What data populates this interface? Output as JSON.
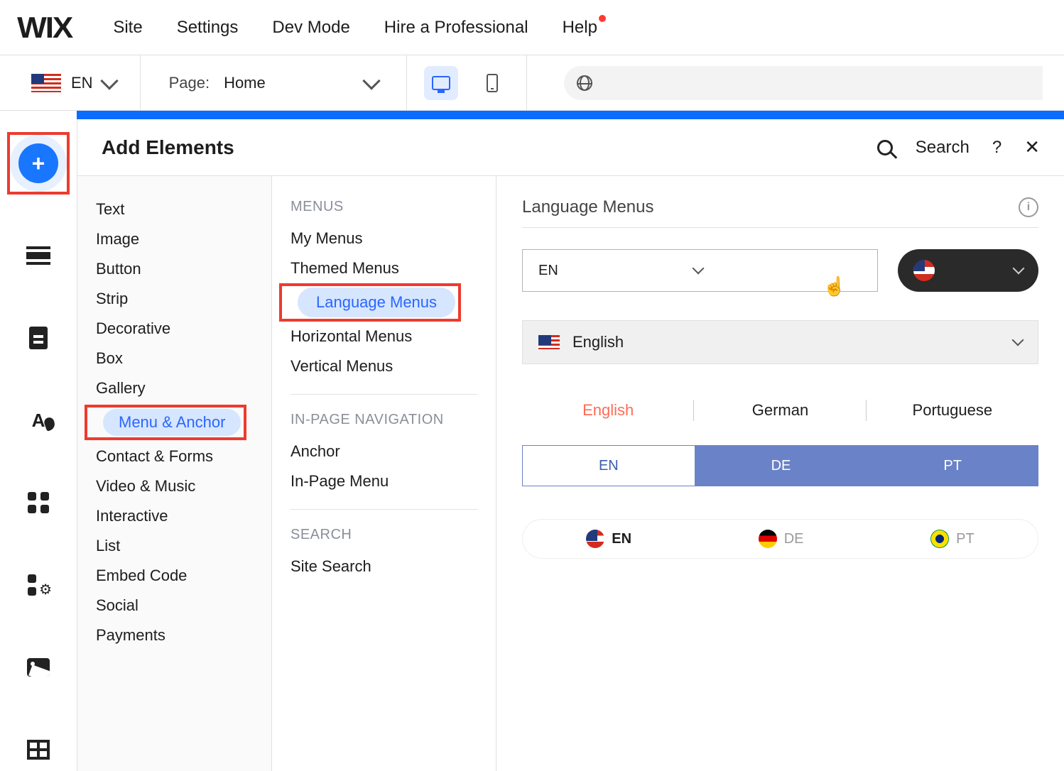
{
  "top": {
    "logo": "WIX",
    "menu": [
      "Site",
      "Settings",
      "Dev Mode",
      "Hire a Professional",
      "Help"
    ]
  },
  "secondbar": {
    "lang_code": "EN",
    "page_label": "Page:",
    "page_value": "Home"
  },
  "panel": {
    "title": "Add Elements",
    "search": "Search",
    "categories": [
      "Text",
      "Image",
      "Button",
      "Strip",
      "Decorative",
      "Box",
      "Gallery",
      "Menu & Anchor",
      "Contact & Forms",
      "Video & Music",
      "Interactive",
      "List",
      "Embed Code",
      "Social",
      "Payments"
    ],
    "selectedCategory": "Menu & Anchor",
    "group_menus_label": "MENUS",
    "menu_items": [
      "My Menus",
      "Themed Menus",
      "Language Menus",
      "Horizontal Menus",
      "Vertical Menus"
    ],
    "selectedMenu": "Language Menus",
    "group_inpage_label": "IN-PAGE NAVIGATION",
    "inpage_items": [
      "Anchor",
      "In-Page Menu"
    ],
    "group_search_label": "SEARCH",
    "search_items": [
      "Site Search"
    ]
  },
  "preview": {
    "title": "Language Menus",
    "dd_en": "EN",
    "dd_english": "English",
    "tabs": [
      "English",
      "German",
      "Portuguese"
    ],
    "seg": [
      "EN",
      "DE",
      "PT"
    ],
    "pills": [
      {
        "code": "EN"
      },
      {
        "code": "DE"
      },
      {
        "code": "PT"
      }
    ]
  }
}
